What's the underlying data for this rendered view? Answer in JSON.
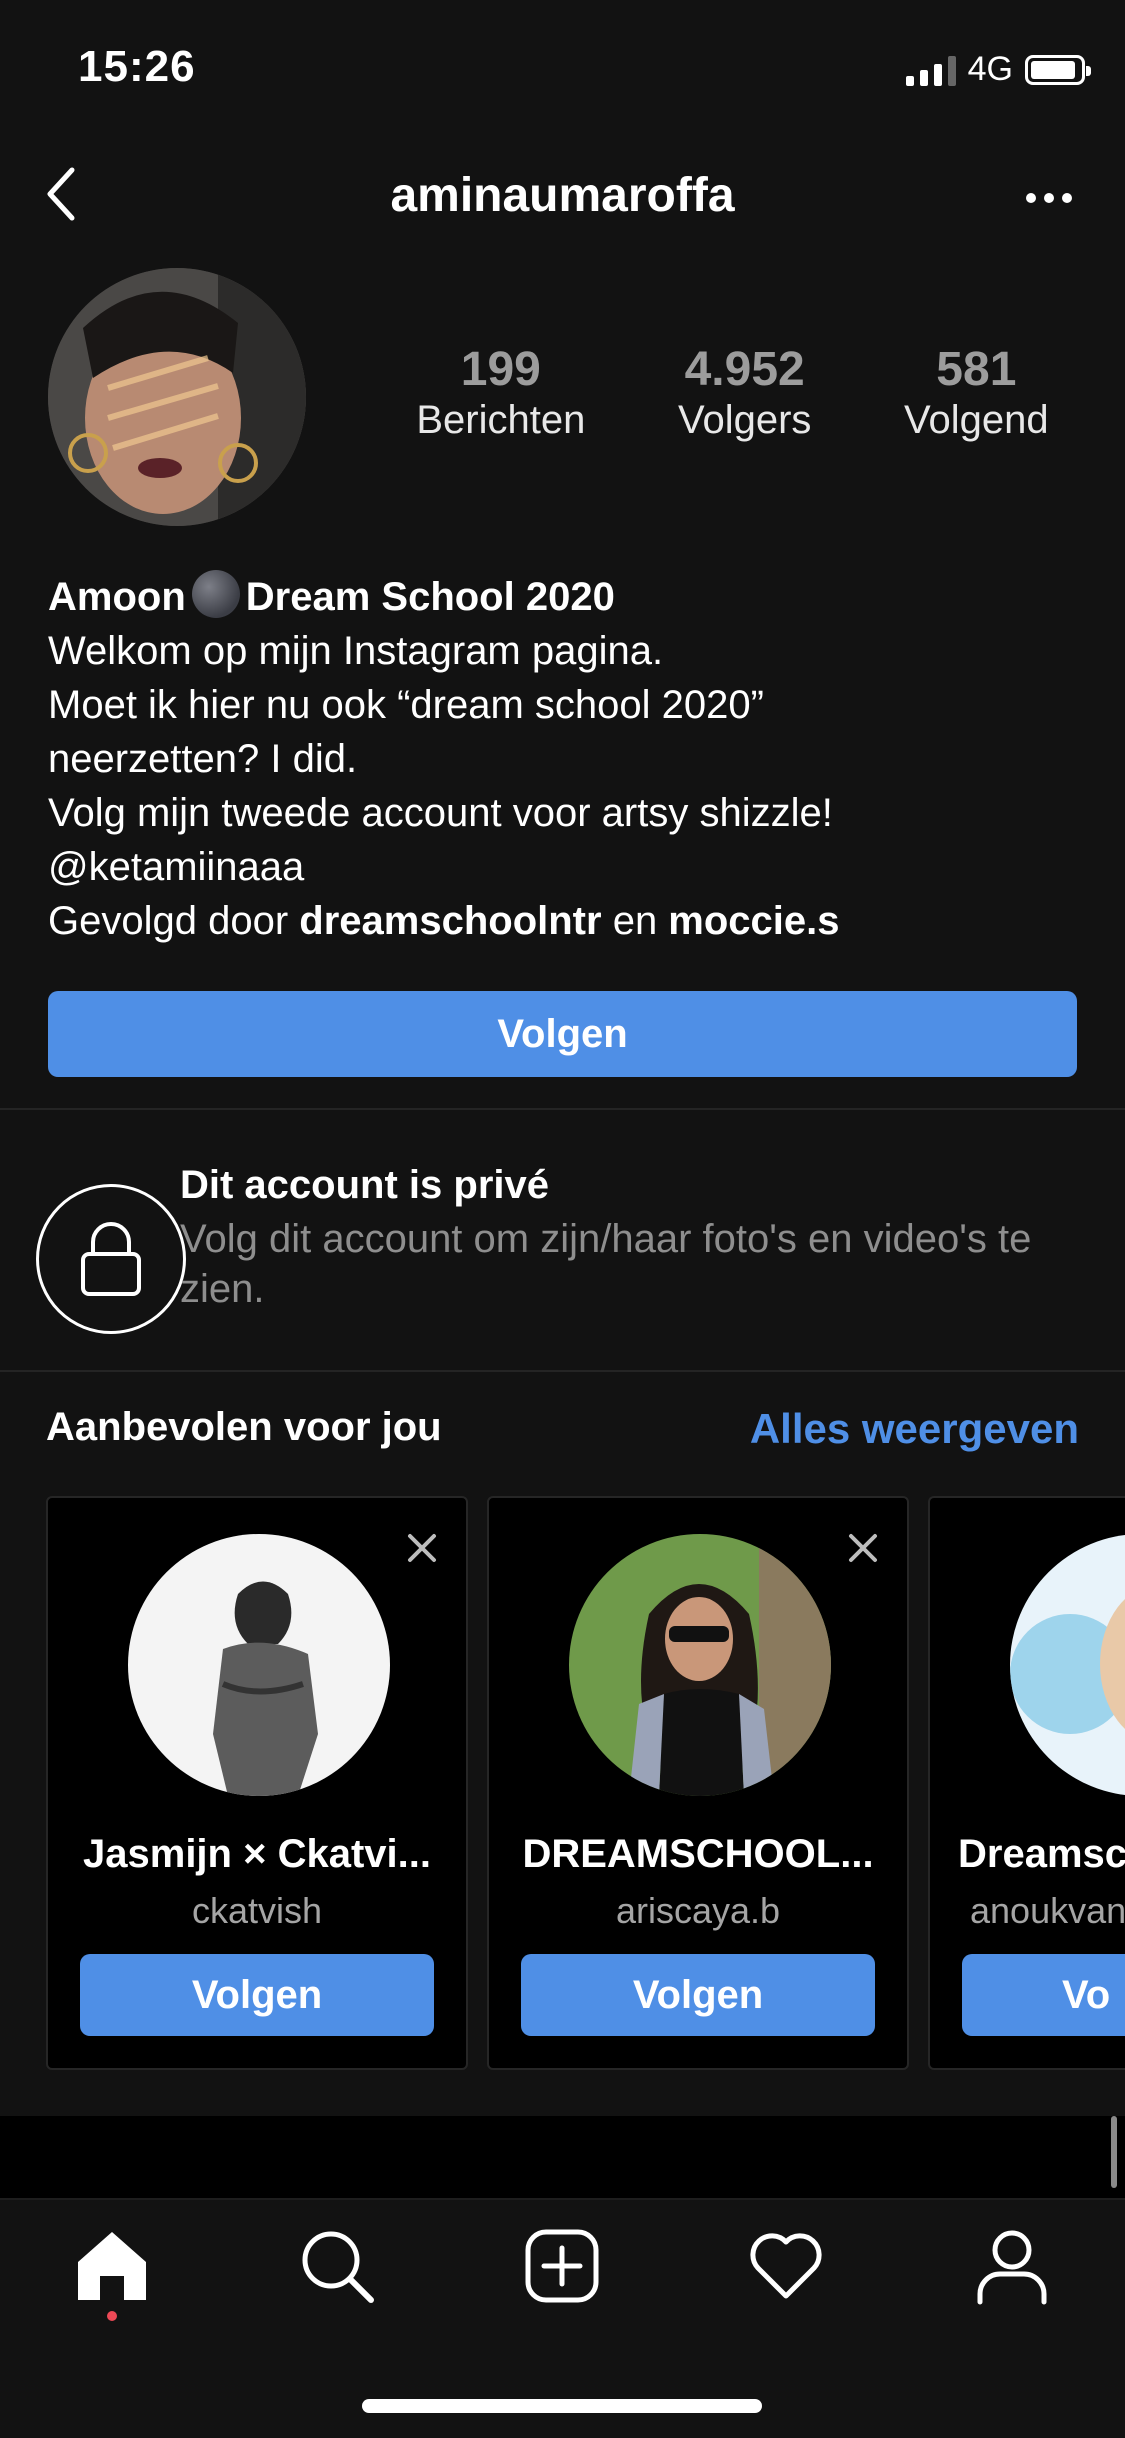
{
  "status_bar": {
    "time": "15:26",
    "network": "4G",
    "battery_level": 0.85
  },
  "header": {
    "username": "aminaumaroffa"
  },
  "stats": [
    {
      "value": "199",
      "label": "Berichten"
    },
    {
      "value": "4.952",
      "label": "Volgers"
    },
    {
      "value": "581",
      "label": "Volgend"
    }
  ],
  "bio": {
    "name_part1": "Amoon",
    "name_part2": "Dream School 2020",
    "line1": "Welkom op mijn Instagram pagina.",
    "line2": "Moet ik hier nu ook “dream school 2020”",
    "line3": "neerzetten? I did.",
    "line4": "Volg mijn tweede account voor artsy shizzle!",
    "line5": "@ketamiinaaa",
    "followed_prefix": "Gevolgd door ",
    "followed_user1": "dreamschoolntr",
    "followed_and": " en ",
    "followed_user2": "moccie.s"
  },
  "follow_button": "Volgen",
  "private": {
    "title": "Dit account is privé",
    "subtitle": "Volg dit account om zijn/haar foto's en video's te zien."
  },
  "recommended": {
    "title": "Aanbevolen voor jou",
    "see_all": "Alles weergeven",
    "cards": [
      {
        "name": "Jasmijn × Ckatvi...",
        "username": "ckatvish",
        "button": "Volgen"
      },
      {
        "name": "DREAMSCHOOL...",
        "username": "ariscaya.b",
        "button": "Volgen"
      },
      {
        "name": "Dreamsc",
        "username": "anoukvan",
        "button": "Vo"
      }
    ]
  },
  "tabbar": [
    "home-icon",
    "search-icon",
    "add-post-icon",
    "heart-icon",
    "profile-icon"
  ],
  "colors": {
    "background": "#121212",
    "accent_blue": "#4f8fe6",
    "notification_red": "#ed4956"
  }
}
